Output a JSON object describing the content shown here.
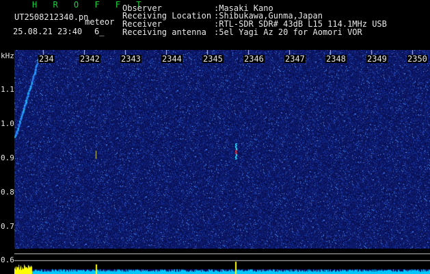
{
  "header": {
    "station": "H R O F F T",
    "filename": "UT2508212340.pn",
    "event_type": "meteor",
    "date_time": "25.08.21 23:40",
    "count": "6_",
    "fields": [
      {
        "label": "Observer",
        "value": ":Masaki Kano"
      },
      {
        "label": "Receiving Location",
        "value": ":Shibukawa,Gunma,Japan"
      },
      {
        "label": "Receiver",
        "value": ":RTL-SDR SDR# 43dB L15 114.1MHz USB"
      },
      {
        "label": "Receiving antenna",
        "value": ":5el Yagi Az 20 for Aomori VOR"
      }
    ]
  },
  "spectrogram": {
    "y_unit": "kHz",
    "y_ticks": [
      "1.1",
      "1.0",
      "0.9",
      "0.8",
      "0.7",
      "0.6"
    ],
    "x_ticks": [
      "234",
      "2342",
      "2343",
      "2344",
      "2345",
      "2346",
      "2347",
      "2348",
      "2349",
      "2350"
    ],
    "colors": {
      "background": "#0a0a5a",
      "noise": "#1e2ab0",
      "signal": "#18e0ff",
      "strong": "#ff3030",
      "lower_band": "#00c8ff",
      "lower_spike": "#ffff00",
      "guide_line": "#c8c8c8"
    }
  }
}
